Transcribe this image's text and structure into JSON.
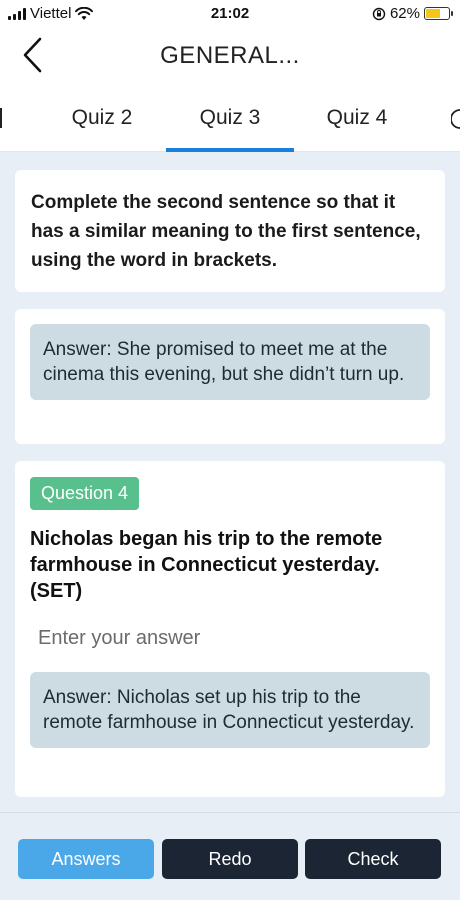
{
  "status": {
    "carrier": "Viettel",
    "time": "21:02",
    "battery": "62%",
    "battery_level": 0.62
  },
  "header": {
    "title": "GENERAL..."
  },
  "tabs": [
    {
      "label": "Quiz 2"
    },
    {
      "label": "Quiz 3",
      "active": true
    },
    {
      "label": "Quiz 4"
    }
  ],
  "instruction": "Complete the second sentence so that it has a similar meaning to the first sentence, using the word in brackets.",
  "previous": {
    "answer": "Answer: She promised to meet me at the cinema this evening, but she didn’t turn up."
  },
  "question": {
    "badge": "Question 4",
    "text": "Nicholas began his trip to the remote farmhouse in Connecticut yesterday. (SET)",
    "placeholder": "Enter your answer",
    "answer": "Answer: Nicholas set up his trip to the remote farmhouse in Connecticut yesterday."
  },
  "buttons": {
    "answers": "Answers",
    "redo": "Redo",
    "check": "Check"
  },
  "colors": {
    "accent": "#1a7fd8",
    "answers_button": "#4aa8e8",
    "dark_button": "#1b2534",
    "badge": "#58c08c",
    "answer_box": "#cddbe3",
    "battery": "#f5c518"
  }
}
